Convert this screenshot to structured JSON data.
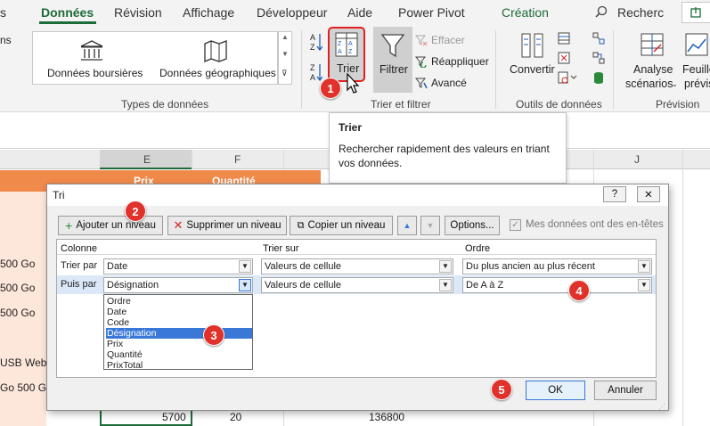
{
  "tabs": [
    "Données",
    "Révision",
    "Affichage",
    "Développeur",
    "Aide",
    "Power Pivot",
    "Création"
  ],
  "search_label": "Recherc",
  "left_fragment": "ns",
  "datatypes": {
    "stocks": "Données boursières",
    "geo": "Données géographiques",
    "group": "Types de données"
  },
  "sort_filter": {
    "sort": "Trier",
    "filter": "Filtrer",
    "clear": "Effacer",
    "reapply": "Réappliquer",
    "advanced": "Avancé",
    "group": "Trier et filtrer"
  },
  "data_tools": {
    "convert": "Convertir",
    "group": "Outils de données"
  },
  "forecast": {
    "analysis1": "Analyse",
    "analysis2": "scénarios",
    "sheet1": "Feuille",
    "sheet2": "prévis",
    "group": "Prévision"
  },
  "tooltip": {
    "title": "Trier",
    "line1": "Rechercher rapidement des valeurs en triant",
    "line2": "vos données."
  },
  "sheet": {
    "cols": [
      "E",
      "F",
      "J"
    ],
    "header_cells": [
      "Prix",
      "Quantité"
    ],
    "left_cells": [
      "500 Go",
      "500 Go",
      "500 Go",
      "USB Webc",
      "Go 500 G"
    ],
    "bottom_values": [
      "5700",
      "20",
      "136800"
    ]
  },
  "dialog": {
    "title": "Tri",
    "help": "?",
    "close": "✕",
    "add_level": "Ajouter un niveau",
    "delete_level": "Supprimer un niveau",
    "copy_level": "Copier un niveau",
    "options": "Options...",
    "has_headers": "Mes données ont des en-têtes",
    "col_header": "Colonne",
    "sort_on_header": "Trier sur",
    "order_header": "Ordre",
    "row1": {
      "label": "Trier par",
      "column": "Date",
      "sort_on": "Valeurs de cellule",
      "order": "Du plus ancien au plus récent"
    },
    "row2": {
      "label": "Puis par",
      "column": "Désignation",
      "sort_on": "Valeurs de cellule",
      "order": "De A à Z"
    },
    "options_list": [
      "Ordre",
      "Date",
      "Code",
      "Désignation",
      "Prix",
      "Quantité",
      "PrixTotal"
    ],
    "selected_option": "Désignation",
    "ok": "OK",
    "cancel": "Annuler"
  },
  "badges": [
    "1",
    "2",
    "3",
    "4",
    "5"
  ],
  "colors": {
    "accent": "#1e6b3a",
    "badge": "#e0312b",
    "selection": "#3a78d8",
    "header_orange": "#f08a4a"
  }
}
